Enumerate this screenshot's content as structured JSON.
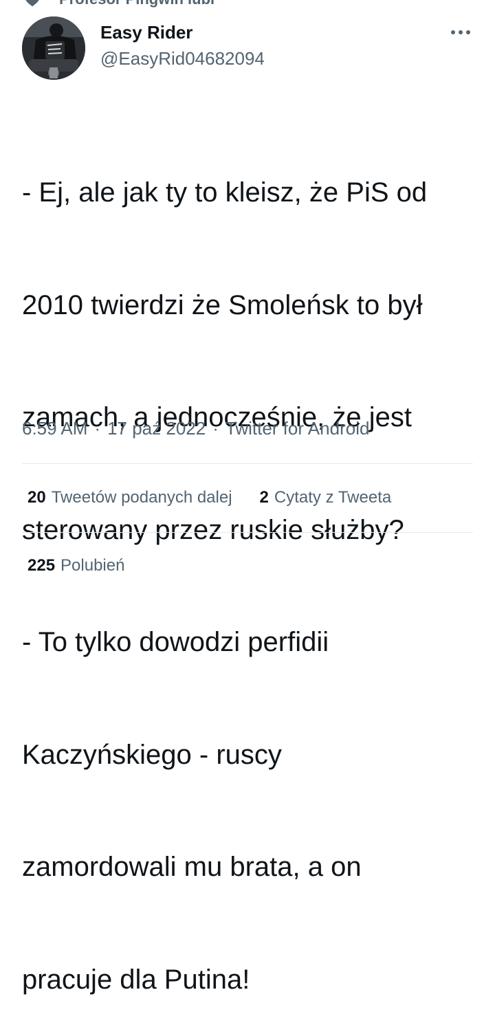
{
  "social_context": {
    "text": "Profesor Pingwin lubi",
    "icon": "heart-icon"
  },
  "author": {
    "display_name": "Easy Rider",
    "handle": "@EasyRid04682094",
    "avatar_icon": "avatar-image"
  },
  "more_icon": "more-dots-icon",
  "tweet": {
    "lines": [
      "- Ej, ale jak ty to kleisz, że PiS od",
      "2010 twierdzi że Smoleńsk to był",
      "zamach, a jednocześnie, że jest",
      "sterowany przez ruskie służby?",
      "- To tylko dowodzi perfidii",
      "Kaczyńskiego - ruscy",
      "zamordowali mu brata, a on",
      "pracuje dla Putina!"
    ]
  },
  "meta": {
    "time": "6:59 AM",
    "separator": "·",
    "date": "17 paź 2022",
    "source": "Twitter for Android"
  },
  "stats": {
    "retweets_count": "20",
    "retweets_label": "Tweetów podanych dalej",
    "quotes_count": "2",
    "quotes_label": "Cytaty z Tweeta",
    "likes_count": "225",
    "likes_label": "Polubień"
  },
  "colors": {
    "text_primary": "#0f1419",
    "text_secondary": "#536471",
    "divider": "#e4e8eb"
  }
}
